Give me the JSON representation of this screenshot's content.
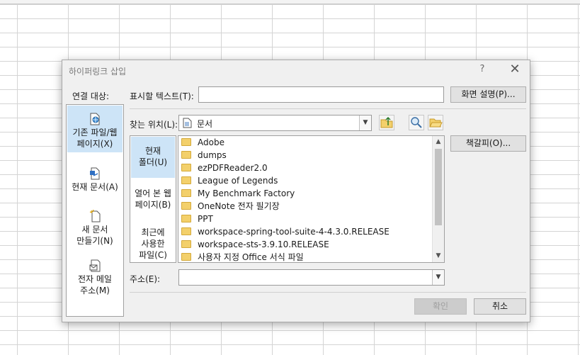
{
  "dialog": {
    "title": "하이퍼링크 삽입",
    "help_glyph": "?",
    "close_glyph": "✕",
    "link_to_label": "연결 대상:",
    "sidebar": [
      {
        "line1": "기존 파일/웹",
        "line2": "페이지(X)",
        "icon": "existing-file-icon",
        "active": true
      },
      {
        "line1": "현재 문서(A)",
        "line2": "",
        "icon": "current-document-icon",
        "active": false
      },
      {
        "line1": "새 문서",
        "line2": "만들기(N)",
        "icon": "new-document-icon",
        "active": false
      },
      {
        "line1": "전자 메일",
        "line2": "주소(M)",
        "icon": "email-icon",
        "active": false
      }
    ],
    "display_text_label": "표시할 텍스트(T):",
    "display_text_value": "",
    "screentip_button": "화면 설명(P)...",
    "look_in_label": "찾는 위치(L):",
    "look_in_value": "문서",
    "bookmark_button": "책갈피(O)...",
    "folder_nav": [
      {
        "line1": "현재",
        "line2": "폴더(U)",
        "line3": "",
        "active": true
      },
      {
        "line1": "열어 본 웹",
        "line2": "페이지(B)",
        "line3": "",
        "active": false
      },
      {
        "line1": "최근에",
        "line2": "사용한",
        "line3": "파일(C)",
        "active": false
      }
    ],
    "files": [
      "Adobe",
      "dumps",
      "ezPDFReader2.0",
      "League of Legends",
      "My Benchmark Factory",
      "OneNote 전자 필기장",
      "PPT",
      "workspace-spring-tool-suite-4-4.3.0.RELEASE",
      "workspace-sts-3.9.10.RELEASE",
      "사용자 지정 Office 서식 파일"
    ],
    "address_label": "주소(E):",
    "address_value": "",
    "ok_button": "확인",
    "cancel_button": "취소"
  }
}
